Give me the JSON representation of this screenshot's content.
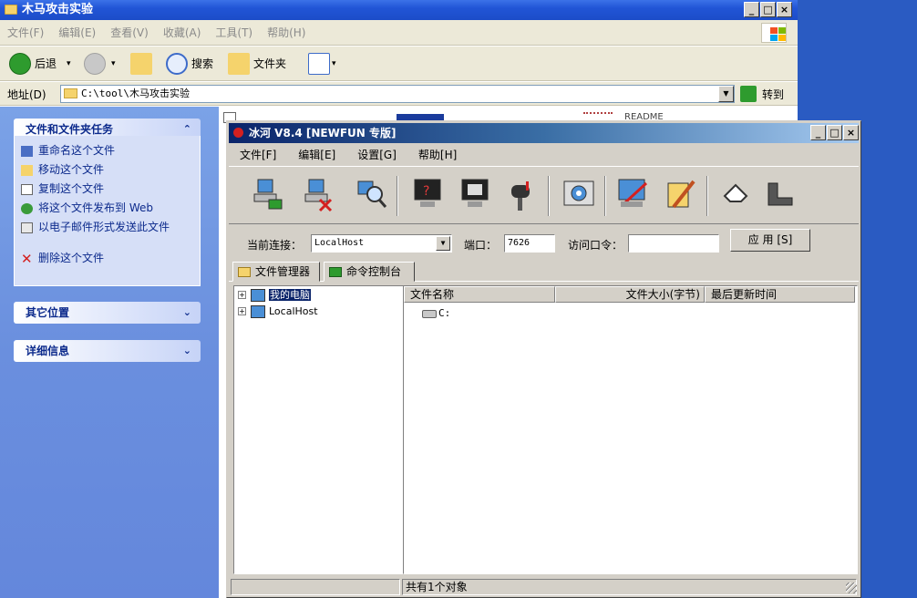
{
  "explorer": {
    "title": "木马攻击实验",
    "menu": [
      "文件(F)",
      "编辑(E)",
      "查看(V)",
      "收藏(A)",
      "工具(T)",
      "帮助(H)"
    ],
    "toolbar": {
      "back": "后退",
      "search": "搜索",
      "folders": "文件夹"
    },
    "address": {
      "label": "地址(D)",
      "value": "C:\\tool\\木马攻击实验",
      "go": "转到"
    },
    "taskpane": {
      "file_tasks": {
        "title": "文件和文件夹任务",
        "items": [
          "重命名这个文件",
          "移动这个文件",
          "复制这个文件",
          "将这个文件发布到 Web",
          "以电子邮件形式发送此文件",
          "删除这个文件"
        ]
      },
      "other_places": {
        "title": "其它位置"
      },
      "details": {
        "title": "详细信息"
      }
    },
    "partial_file_label": "README"
  },
  "binghe": {
    "title": "冰河 V8.4 [NEWFUN 专版]",
    "menu": [
      "文件[F]",
      "编辑[E]",
      "设置[G]",
      "帮助[H]"
    ],
    "connection": {
      "label": "当前连接：",
      "value": "LocalHost",
      "port_label": "端口：",
      "port": "7626",
      "password_label": "访问口令：",
      "password": "",
      "apply": "应 用 [S]"
    },
    "tabs": [
      "文件管理器",
      "命令控制台"
    ],
    "tree": [
      "我的电脑",
      "LocalHost"
    ],
    "list": {
      "columns": [
        "文件名称",
        "文件大小(字节)",
        "最后更新时间"
      ],
      "rows": [
        {
          "name": "C:"
        }
      ]
    },
    "status": "共有1个对象"
  },
  "colors": {
    "xp_title": "#2155d6",
    "desktop": "#2a5bc2",
    "bh_title_start": "#0a246a",
    "bh_title_end": "#a6caf0"
  }
}
